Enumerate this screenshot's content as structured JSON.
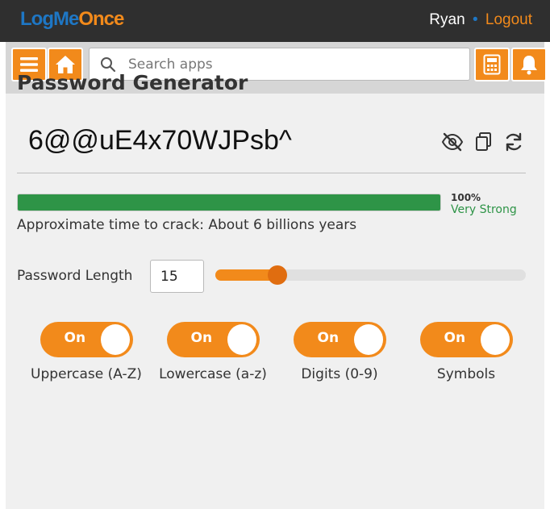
{
  "header": {
    "logo_part1": "LogMe",
    "logo_part2": "Once",
    "user_name": "Ryan",
    "separator": "•",
    "logout_label": "Logout"
  },
  "toolbar": {
    "search_placeholder": "Search apps",
    "buttons": [
      "menu-icon",
      "home-icon",
      "calculator-icon",
      "bell-icon"
    ]
  },
  "generator": {
    "title": "Password Generator",
    "password": "6@@uE4x70WJPsb^",
    "actions": [
      "eye-slash-icon",
      "copy-icon",
      "refresh-icon"
    ],
    "strength_percent_label": "100%",
    "strength_value": 1.0,
    "strength_label": "Very Strong",
    "crack_text": "Approximate time to crack: About 6 billions years",
    "length_label": "Password Length",
    "length_value": "15",
    "length_slider_fraction": 0.2
  },
  "toggles": [
    {
      "state": "On",
      "label": "Uppercase (A-Z)"
    },
    {
      "state": "On",
      "label": "Lowercase (a-z)"
    },
    {
      "state": "On",
      "label": "Digits (0-9)"
    },
    {
      "state": "On",
      "label": "Symbols"
    }
  ],
  "colors": {
    "accent": "#f28a1b",
    "brand_blue": "#1e77c5",
    "strength_green": "#2e9447",
    "topbar": "#2f2f2f",
    "panel": "#f0f0f0"
  }
}
